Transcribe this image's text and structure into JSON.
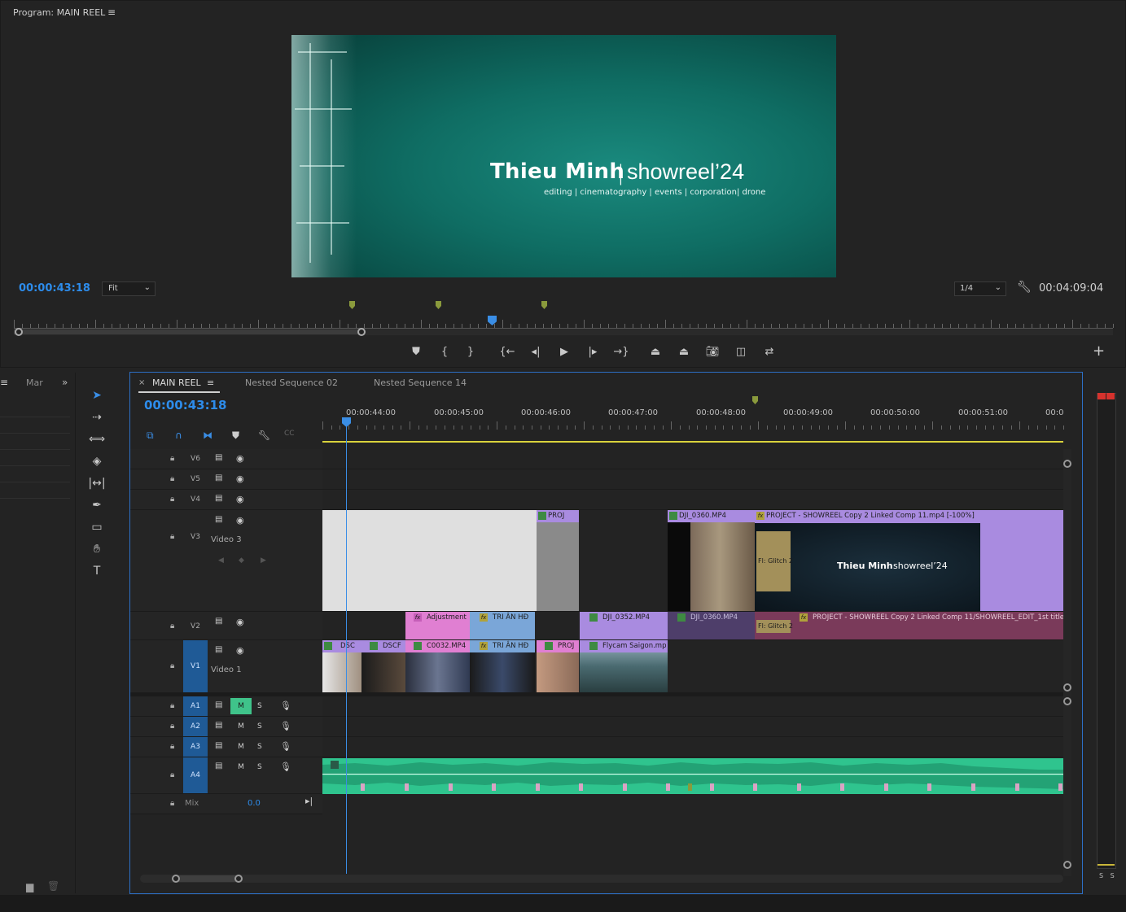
{
  "program": {
    "title": "Program: MAIN REEL",
    "menu_icon": "hamburger-icon",
    "timecode_current": "00:00:43:18",
    "fit_option": "Fit",
    "resolution": "1/4",
    "timecode_duration": "00:04:09:04",
    "video": {
      "name": "Thieu Minh",
      "separator": "|",
      "showreel": "showreel’24",
      "subtitle": "editing | cinematography | events | corporation| drone"
    }
  },
  "left_panel": {
    "tab": "Mar",
    "more": "»"
  },
  "timeline": {
    "tabs": [
      {
        "label": "MAIN REEL",
        "active": true
      },
      {
        "label": "Nested Sequence 02"
      },
      {
        "label": "Nested Sequence 14"
      }
    ],
    "close": "×",
    "timecode": "00:00:43:18",
    "ruler_labels": [
      "00:00:44:00",
      "00:00:45:00",
      "00:00:46:00",
      "00:00:47:00",
      "00:00:48:00",
      "00:00:49:00",
      "00:00:50:00",
      "00:00:51:00",
      "00:0"
    ],
    "tracks": {
      "v6": "V6",
      "v5": "V5",
      "v4": "V4",
      "v3": "V3",
      "v3_name": "Video 3",
      "v2": "V2",
      "v1": "V1",
      "v1_name": "Video 1",
      "a1": "A1",
      "a2": "A2",
      "a3": "A3",
      "a4": "A4",
      "m": "M",
      "s": "S",
      "mix_label": "Mix",
      "mix_value": "0.0"
    },
    "clips": {
      "v3_proj": "PROJ",
      "v3_dji": "DJI_0360.MP4",
      "v3_project": "PROJECT - SHOWREEL Copy 2 Linked Comp 11.mp4 [-100%]",
      "v3_glitch": "Fl: Glitch 2",
      "v3_thumb_name": "Thieu Minh",
      "v3_thumb_show": "showreel’24",
      "v2_adjust": "Adjustment",
      "v2_trian": "TRI ÂN HĐ",
      "v2_dji352": "DJI_0352.MP4",
      "v2_dji360": "DJI_0360.MP4",
      "v2_glitch": "Fl: Glitch 2",
      "v2_project": "PROJECT - SHOWREEL Copy 2 Linked Comp 11/SHOWREEL_EDIT_1st title.",
      "v1_dsc": "DSC",
      "v1_dscf": "DSCF",
      "v1_c0032": "C0032.MP4",
      "v1_trian": "TRI ÂN HĐ",
      "v1_proj": "PROJ",
      "v1_flycam": "Flycam Saigon.mp",
      "fx": "fx"
    }
  },
  "meter": {
    "ss": "S S"
  },
  "colors": {
    "accent_blue": "#2d8ceb",
    "clip_purple": "#a98be0",
    "clip_pink": "#e07fd2",
    "clip_blue": "#7aa6d8",
    "audio_green": "#2fc48e",
    "marker_green": "#8a9a3c"
  }
}
